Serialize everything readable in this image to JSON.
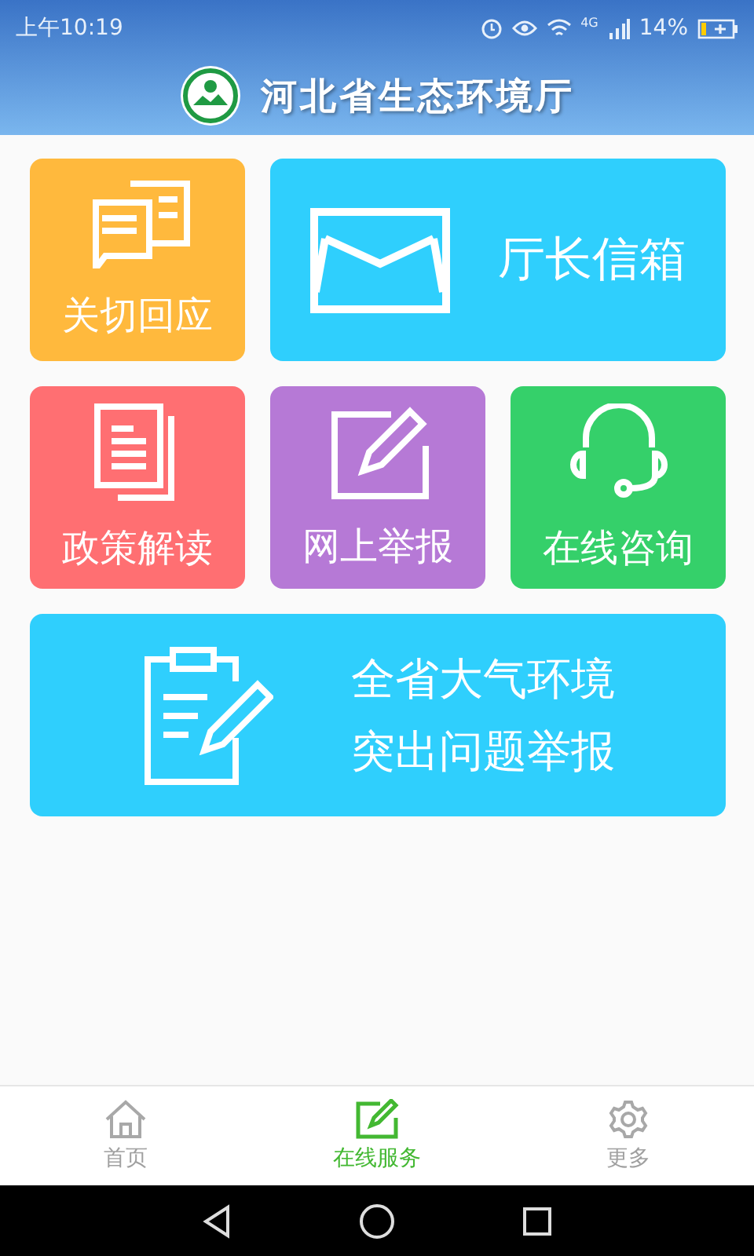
{
  "status_bar": {
    "time": "上午10:19",
    "network": "4G",
    "battery": "14%"
  },
  "header": {
    "title": "河北省生态环境厅"
  },
  "tiles": [
    {
      "kind": "small",
      "label": "关切回应",
      "color": "#ffb93d"
    },
    {
      "kind": "wide",
      "label": "厅长信箱",
      "color": "#2fcffd"
    },
    {
      "kind": "small",
      "label": "政策解读",
      "color": "#ff6f72"
    },
    {
      "kind": "small",
      "label": "网上举报",
      "color": "#b679d6"
    },
    {
      "kind": "small",
      "label": "在线咨询",
      "color": "#35d06a"
    },
    {
      "kind": "banner",
      "lines": [
        "全省大气环境",
        "突出问题举报"
      ],
      "color": "#2fcffd"
    }
  ],
  "tabs": [
    {
      "label": "首页",
      "selected": false
    },
    {
      "label": "在线服务",
      "selected": true
    },
    {
      "label": "更多",
      "selected": false
    }
  ]
}
